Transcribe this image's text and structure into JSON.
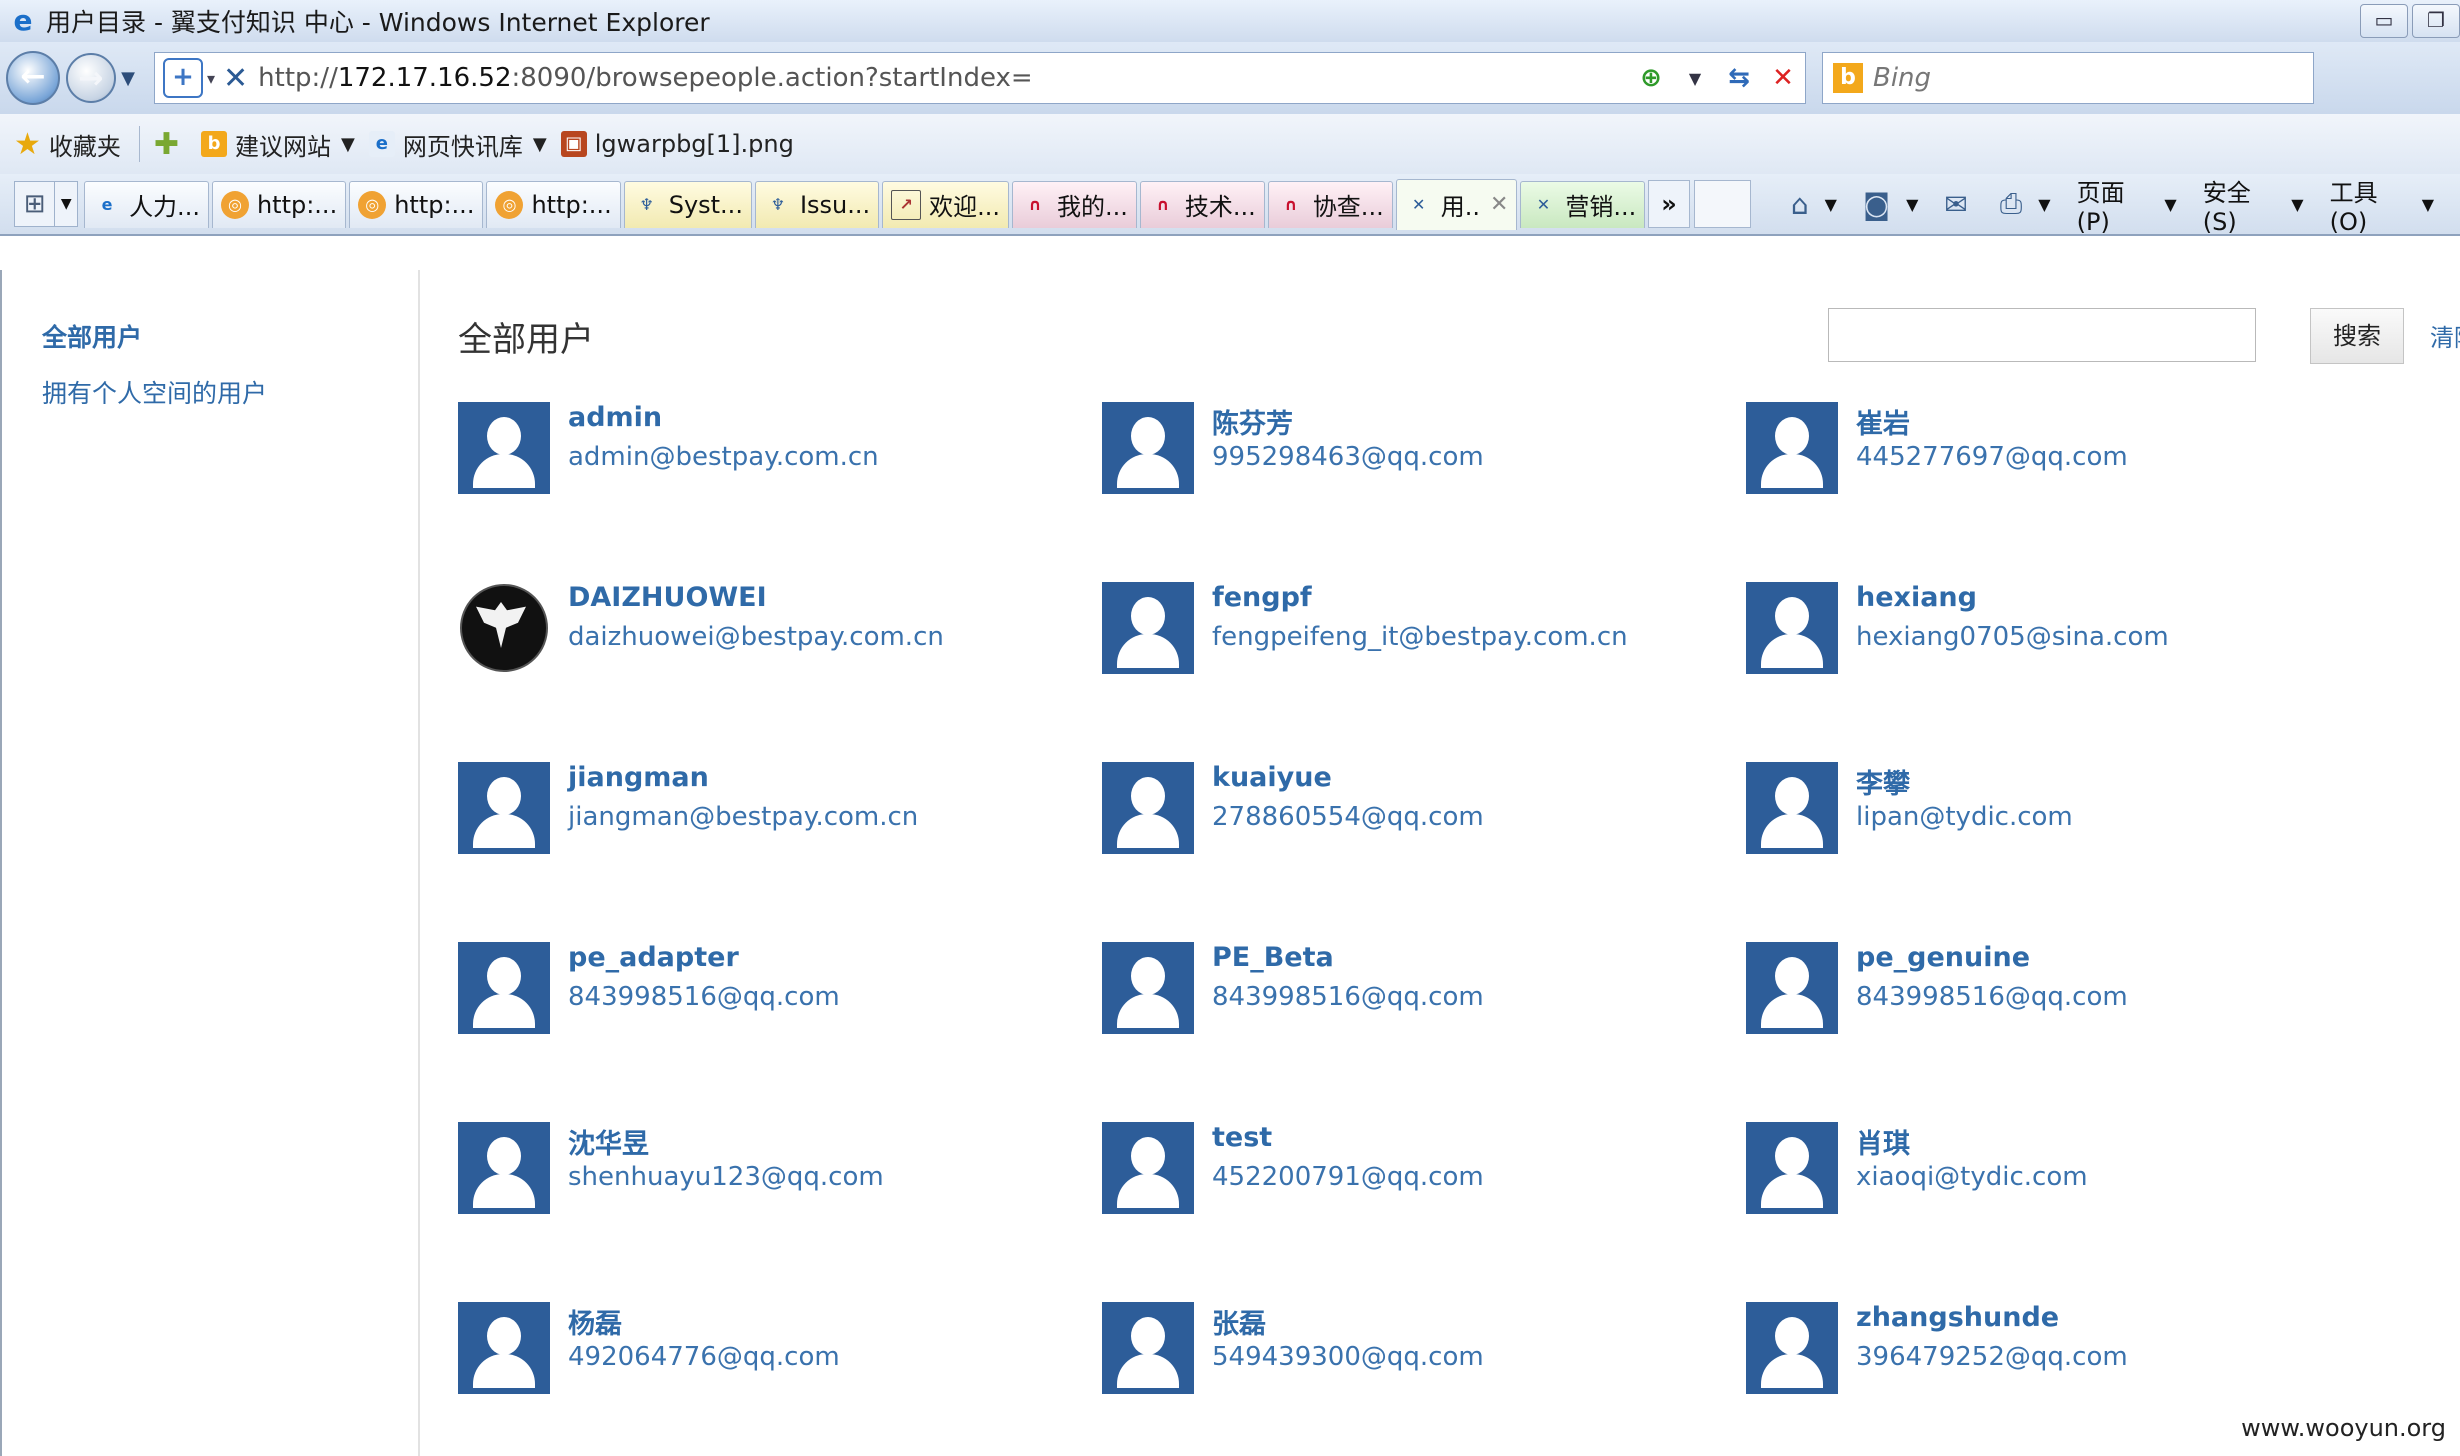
{
  "window": {
    "title": "用户目录 - 翼支付知识 中心 - Windows Internet Explorer",
    "minimize_glyph": "▭"
  },
  "address_bar": {
    "url_prefix": "http://",
    "url_host": "172.17.16.52",
    "url_rest": ":8090/browsepeople.action?startIndex=",
    "search_placeholder": "Bing"
  },
  "favorites_bar": {
    "favorites_label": "收藏夹",
    "items": [
      {
        "label": "建议网站"
      },
      {
        "label": "网页快讯库"
      },
      {
        "label": "lgwarpbg[1].png"
      }
    ]
  },
  "tabs": [
    {
      "label": "人力..."
    },
    {
      "label": "http:..."
    },
    {
      "label": "http:..."
    },
    {
      "label": "http:..."
    },
    {
      "label": "Syst..."
    },
    {
      "label": "Issu..."
    },
    {
      "label": "欢迎..."
    },
    {
      "label": "我的..."
    },
    {
      "label": "技术..."
    },
    {
      "label": "协查..."
    },
    {
      "label": "用.."
    },
    {
      "label": "营销..."
    }
  ],
  "tab_more": "»",
  "command_bar": {
    "page": "页面(P)",
    "safety": "安全(S)",
    "tools": "工具(O)"
  },
  "sidebar": {
    "items": [
      {
        "label": "全部用户"
      },
      {
        "label": "拥有个人空间的用户"
      }
    ]
  },
  "main": {
    "title": "全部用户",
    "search_button": "搜索",
    "clear_link": "清除"
  },
  "users": [
    {
      "name": "admin",
      "email": "admin@bestpay.com.cn",
      "avatar": "default"
    },
    {
      "name": "陈芬芳",
      "email": "995298463@qq.com",
      "avatar": "default"
    },
    {
      "name": "崔岩",
      "email": "445277697@qq.com",
      "avatar": "default"
    },
    {
      "name": "DAIZHUOWEI",
      "email": "daizhuowei@bestpay.com.cn",
      "avatar": "shield"
    },
    {
      "name": "fengpf",
      "email": "fengpeifeng_it@bestpay.com.cn",
      "avatar": "default"
    },
    {
      "name": "hexiang",
      "email": "hexiang0705@sina.com",
      "avatar": "default"
    },
    {
      "name": "jiangman",
      "email": "jiangman@bestpay.com.cn",
      "avatar": "default"
    },
    {
      "name": "kuaiyue",
      "email": "278860554@qq.com",
      "avatar": "default"
    },
    {
      "name": "李攀",
      "email": "lipan@tydic.com",
      "avatar": "default"
    },
    {
      "name": "pe_adapter",
      "email": "843998516@qq.com",
      "avatar": "default"
    },
    {
      "name": "PE_Beta",
      "email": "843998516@qq.com",
      "avatar": "default"
    },
    {
      "name": "pe_genuine",
      "email": "843998516@qq.com",
      "avatar": "default"
    },
    {
      "name": "沈华昱",
      "email": "shenhuayu123@qq.com",
      "avatar": "default"
    },
    {
      "name": "test",
      "email": "452200791@qq.com",
      "avatar": "default"
    },
    {
      "name": "肖琪",
      "email": "xiaoqi@tydic.com",
      "avatar": "default"
    },
    {
      "name": "杨磊",
      "email": "492064776@qq.com",
      "avatar": "default"
    },
    {
      "name": "张磊",
      "email": "549439300@qq.com",
      "avatar": "default"
    },
    {
      "name": "zhangshunde",
      "email": "396479252@qq.com",
      "avatar": "default"
    }
  ],
  "watermark": "www.wooyun.org"
}
